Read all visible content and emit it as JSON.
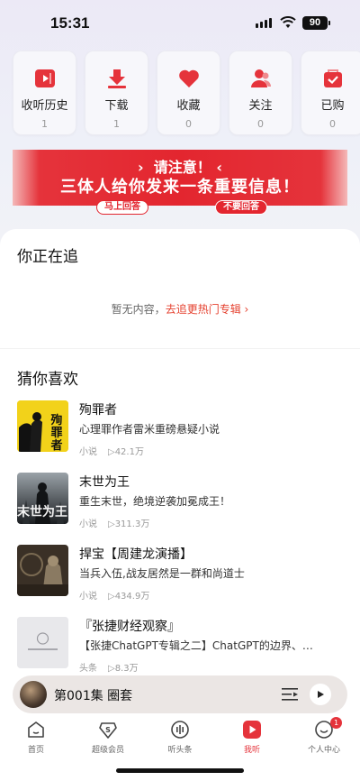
{
  "status_bar": {
    "time": "15:31",
    "battery": "90"
  },
  "shortcuts": [
    {
      "label": "收听历史",
      "count": "1",
      "icon": "history-icon"
    },
    {
      "label": "下载",
      "count": "1",
      "icon": "download-icon"
    },
    {
      "label": "收藏",
      "count": "0",
      "icon": "heart-icon"
    },
    {
      "label": "关注",
      "count": "0",
      "icon": "follow-icon"
    },
    {
      "label": "已购",
      "count": "0",
      "icon": "purchased-icon"
    }
  ],
  "banner": {
    "top": "请注意！",
    "main": "三体人给你发来一条重要信息！",
    "reply": "马上回答",
    "skip": "不要回答"
  },
  "following": {
    "title": "你正在追",
    "empty_text": "暂无内容，",
    "link": "去追更热门专辑 ›"
  },
  "guess": {
    "title": "猜你喜欢",
    "books": [
      {
        "title": "殉罪者",
        "desc": "心理罪作者雷米重磅悬疑小说",
        "category": "小说",
        "plays": "▷42.1万"
      },
      {
        "title": "末世为王",
        "desc": "重生末世，绝境逆袭加冕成王！",
        "category": "小说",
        "plays": "▷311.3万"
      },
      {
        "title": "捍宝【周建龙演播】",
        "desc": "当兵入伍,战友居然是一群和尚道士",
        "category": "小说",
        "plays": "▷434.9万"
      },
      {
        "title": "『张捷财经观察』",
        "desc": "【张捷ChatGPT专辑之二】ChatGPT的边界、…",
        "category": "头条",
        "plays": "▷8.3万"
      }
    ]
  },
  "player": {
    "title": "第001集 圈套"
  },
  "tabs": [
    {
      "label": "首页",
      "icon": "home-icon"
    },
    {
      "label": "超级会员",
      "icon": "vip-icon"
    },
    {
      "label": "听头条",
      "icon": "headline-icon"
    },
    {
      "label": "我听",
      "icon": "my-listen-icon"
    },
    {
      "label": "个人中心",
      "icon": "profile-icon",
      "badge": "1"
    }
  ],
  "colors": {
    "accent": "#e5333b",
    "link": "#e5412f"
  }
}
